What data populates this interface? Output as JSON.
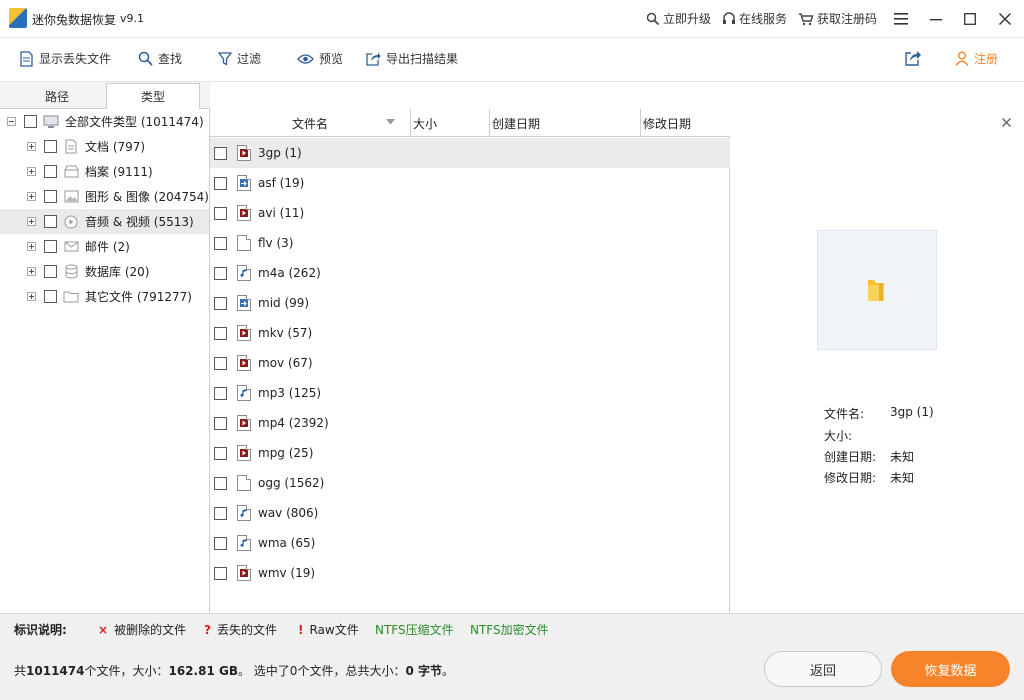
{
  "app": {
    "title": "迷你兔数据恢复",
    "version": "v9.1"
  },
  "titlebar": {
    "upgrade": "立即升级",
    "online_service": "在线服务",
    "get_code": "获取注册码"
  },
  "toolbar": {
    "show_lost": "显示丢失文件",
    "find": "查找",
    "filter": "过滤",
    "preview": "预览",
    "export": "导出扫描结果",
    "register": "注册"
  },
  "tabs": {
    "path": "路径",
    "type": "类型"
  },
  "tree": [
    {
      "label": "全部文件类型 (1011474)",
      "icon": "computer-icon"
    },
    {
      "label": "文档 (797)",
      "icon": "document-icon"
    },
    {
      "label": "档案 (9111)",
      "icon": "archive-icon"
    },
    {
      "label": "图形 & 图像 (204754)",
      "icon": "image-icon"
    },
    {
      "label": "音频 & 视频 (5513)",
      "icon": "media-icon"
    },
    {
      "label": "邮件 (2)",
      "icon": "mail-icon"
    },
    {
      "label": "数据库 (20)",
      "icon": "database-icon"
    },
    {
      "label": "其它文件 (791277)",
      "icon": "folder-icon"
    }
  ],
  "columns": {
    "name": "文件名",
    "size": "大小",
    "created": "创建日期",
    "modified": "修改日期"
  },
  "files": [
    {
      "name": "3gp (1)",
      "icon": "video-file-icon"
    },
    {
      "name": "asf (19)",
      "icon": "media-file-icon"
    },
    {
      "name": "avi (11)",
      "icon": "video-file-icon"
    },
    {
      "name": "flv (3)",
      "icon": "blank-file-icon"
    },
    {
      "name": "m4a (262)",
      "icon": "audio-file-icon"
    },
    {
      "name": "mid (99)",
      "icon": "media-file-icon"
    },
    {
      "name": "mkv (57)",
      "icon": "video-file-icon"
    },
    {
      "name": "mov (67)",
      "icon": "video-file-icon"
    },
    {
      "name": "mp3 (125)",
      "icon": "audio-file-icon"
    },
    {
      "name": "mp4 (2392)",
      "icon": "video-file-icon"
    },
    {
      "name": "mpg (25)",
      "icon": "video-file-icon"
    },
    {
      "name": "ogg (1562)",
      "icon": "blank-file-icon"
    },
    {
      "name": "wav (806)",
      "icon": "audio-file-icon"
    },
    {
      "name": "wma (65)",
      "icon": "audio-file-icon"
    },
    {
      "name": "wmv (19)",
      "icon": "video-file-icon"
    }
  ],
  "preview": {
    "name_label": "文件名:",
    "name_value": "3gp (1)",
    "size_label": "大小:",
    "size_value": "",
    "created_label": "创建日期:",
    "created_value": "未知",
    "modified_label": "修改日期:",
    "modified_value": "未知"
  },
  "legend": {
    "title": "标识说明:",
    "deleted_mark": "×",
    "deleted": "被删除的文件",
    "lost_mark": "?",
    "lost": "丢失的文件",
    "raw_mark": "!",
    "raw": "Raw文件",
    "ntfs_compressed": "NTFS压缩文件",
    "ntfs_encrypted": "NTFS加密文件"
  },
  "status": {
    "prefix": "共",
    "file_count": "1011474",
    "files_size": "个文件，大小：",
    "total_size": "162.81 GB",
    "selected_prefix": "。 选中了",
    "selected_count": "0",
    "selected_middle": "个文件，总共大小：",
    "selected_size": "0 字节",
    "suffix": "。"
  },
  "buttons": {
    "back": "返回",
    "recover": "恢复数据"
  },
  "colors": {
    "accent": "#f7842a",
    "deleted": "#e02020",
    "ntfs": "#2a8c2a"
  }
}
